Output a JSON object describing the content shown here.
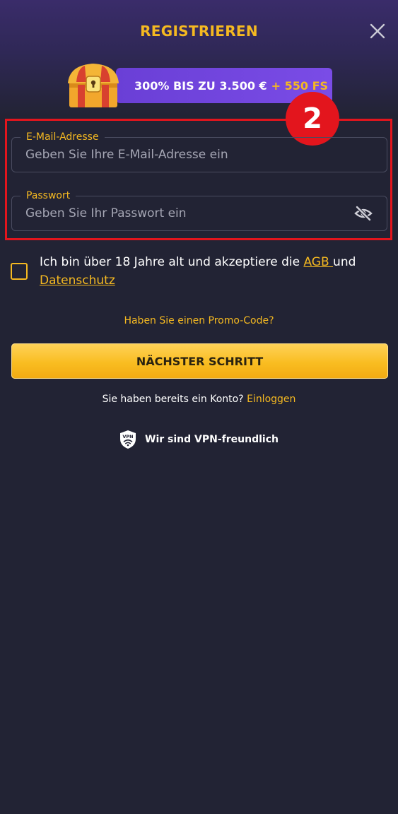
{
  "header": {
    "title": "REGISTRIEREN"
  },
  "bonus": {
    "main": "300% BIS ZU 3.500 €",
    "extra": "+ 550 FS"
  },
  "step_badge": "2",
  "form": {
    "email": {
      "label": "E-Mail-Adresse",
      "placeholder": "Geben Sie Ihre E-Mail-Adresse ein"
    },
    "password": {
      "label": "Passwort",
      "placeholder": "Geben Sie Ihr Passwort ein"
    }
  },
  "terms": {
    "text_before": "Ich bin über 18 Jahre alt und akzeptiere die ",
    "agb_link": "AGB ",
    "text_middle": "und",
    "privacy_link": "Datenschutz"
  },
  "promo_link": "Haben Sie einen Promo-Code?",
  "next_button": "NÄCHSTER SCHRITT",
  "login": {
    "text": "Sie haben bereits ein Konto?",
    "link": "Einloggen"
  },
  "vpn": {
    "label": "Wir sind VPN-freundlich",
    "icon_text": "VPN"
  },
  "colors": {
    "accent": "#f5b921",
    "highlight": "#e3151d",
    "background": "#222334",
    "bonus_bg": "#7a4ce6"
  }
}
